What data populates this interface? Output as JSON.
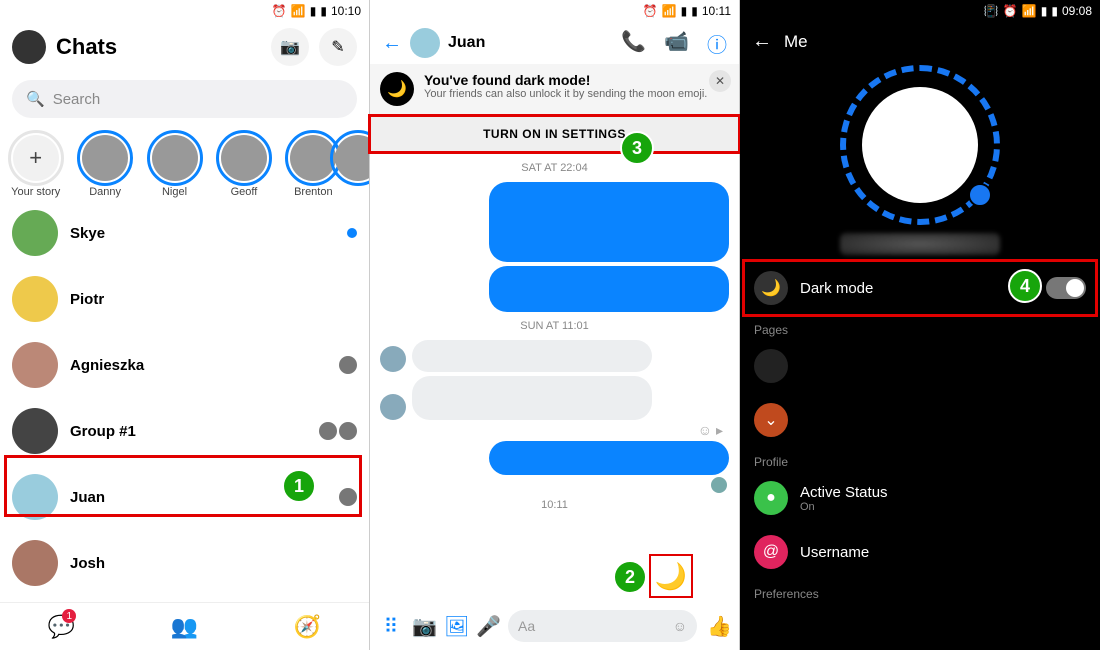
{
  "panel1": {
    "status_time": "10:10",
    "title": "Chats",
    "search_placeholder": "Search",
    "your_story_label": "Your story",
    "stories": [
      {
        "name": "Danny"
      },
      {
        "name": "Nigel"
      },
      {
        "name": "Geoff"
      },
      {
        "name": "Brenton"
      }
    ],
    "chats": [
      {
        "name": "Skye",
        "unread": true
      },
      {
        "name": "Piotr"
      },
      {
        "name": "Agnieszka",
        "seen": true
      },
      {
        "name": "Group #1",
        "seen": true
      },
      {
        "name": "Juan",
        "seen": true,
        "highlighted": true
      },
      {
        "name": "Josh"
      }
    ],
    "nav_badge": "1",
    "step_label": "1"
  },
  "panel2": {
    "status_time": "10:11",
    "contact_name": "Juan",
    "banner_title": "You've found dark mode!",
    "banner_sub": "Your friends can also unlock it by sending the moon emoji.",
    "settings_button": "TURN ON IN SETTINGS",
    "ts1": "SAT AT 22:04",
    "ts2": "SUN AT 11:01",
    "ts3": "10:11",
    "composer_placeholder": "Aa",
    "moon_emoji": "🌙",
    "step3_label": "3",
    "step2_label": "2"
  },
  "panel3": {
    "status_time": "09:08",
    "title": "Me",
    "dark_mode_label": "Dark mode",
    "section_pages": "Pages",
    "section_profile": "Profile",
    "active_status_label": "Active Status",
    "active_status_value": "On",
    "username_label": "Username",
    "section_prefs": "Preferences",
    "step_label": "4"
  }
}
